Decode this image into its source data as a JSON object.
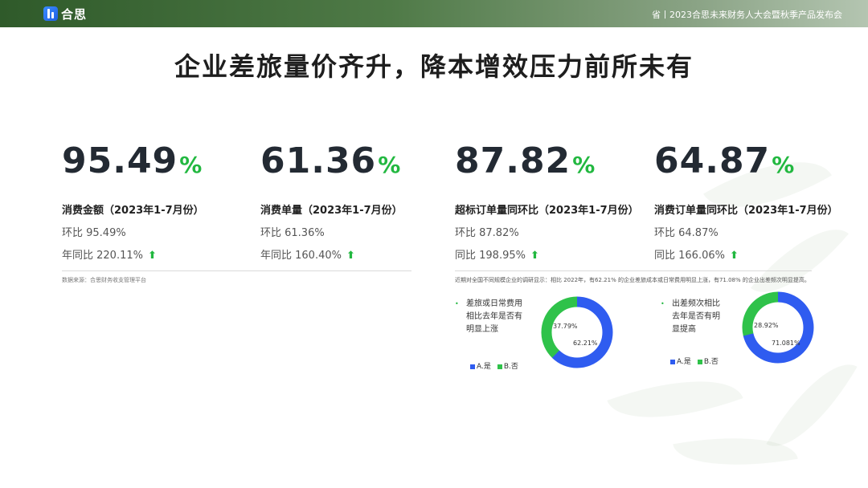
{
  "header": {
    "logo_text": "合思",
    "info": "省丨2023合思未来财务人大会暨秋季产品发布会"
  },
  "title": "企业差旅量价齐升，降本增效压力前所未有",
  "metrics": [
    {
      "value": "95.49",
      "unit": "%",
      "label": "消费金额（2023年1-7月份）",
      "line1": "环比 95.49%",
      "line2": "年同比 220.11%",
      "trend": "⬆"
    },
    {
      "value": "61.36",
      "unit": "%",
      "label": "消费单量（2023年1-7月份）",
      "line1": "环比 61.36%",
      "line2": "年同比 160.40%",
      "trend": "⬆"
    },
    {
      "value": "87.82",
      "unit": "%",
      "label": "超标订单量同环比（2023年1-7月份）",
      "line1": "环比 87.82%",
      "line2": "同比 198.95%",
      "trend": "⬆"
    },
    {
      "value": "64.87",
      "unit": "%",
      "label": "消费订单量同环比（2023年1-7月份）",
      "line1": "环比 64.87%",
      "line2": "同比 166.06%",
      "trend": "⬆"
    }
  ],
  "source": "数据来源：合思财务收支管理平台",
  "survey_note": "近期对全国不同规模企业的调研显示：相比 2022年，有62.21% 的企业差旅成本或日常费用明显上涨，有71.08% 的企业出差频次明显提高。",
  "polls": [
    {
      "bullet": "•",
      "question_lines": [
        "差旅或日常费用",
        "相比去年是否有",
        "明显上涨"
      ],
      "legend": [
        "A.是",
        "B.否"
      ],
      "yes_pct": 62.21,
      "no_pct": 37.79,
      "yes_label": "62.21%",
      "no_label": "37.79%"
    },
    {
      "bullet": "•",
      "question_lines": [
        "出差频次相比",
        "去年是否有明",
        "显提高"
      ],
      "legend": [
        "A.是",
        "B.否"
      ],
      "yes_pct": 71.08,
      "no_pct": 28.92,
      "yes_label": "71.081%",
      "no_label": "28.92%"
    }
  ],
  "colors": {
    "yes": "#2f5cf0",
    "no": "#2fc24a",
    "accent": "#22b840"
  }
}
